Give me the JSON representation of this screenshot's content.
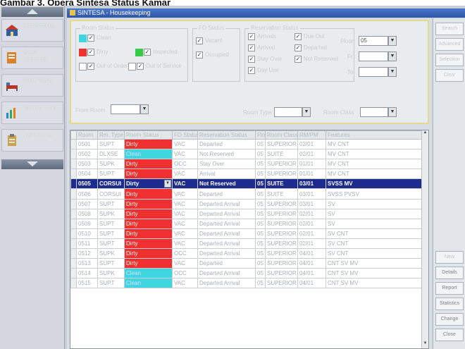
{
  "caption": "Gambar 3. Opera Sintesa Status Kamar",
  "window": {
    "title": "SINTESA - Housekeeping"
  },
  "nav": {
    "items": [
      {
        "label": "Housekeeping",
        "icon": "house-icon"
      },
      {
        "label": "Guest Credentials",
        "icon": "document-icon"
      },
      {
        "label": "Room Status",
        "icon": "bed-icon"
      },
      {
        "label": "Situation Chart",
        "icon": "chart-icon"
      },
      {
        "label": "Maintenance",
        "icon": "clipboard-icon"
      }
    ]
  },
  "filters": {
    "room_status": {
      "title": "Room Status",
      "clean": "Clean",
      "dirty": "Dirty",
      "inspected": "Inspected",
      "out_of_order": "Out of Order",
      "out_of_service": "Out of Service"
    },
    "fo_status": {
      "title": "FO Status",
      "vacant": "Vacant",
      "occupied": "Occupied"
    },
    "reservation_status": {
      "title": "Reservation Status",
      "arrivals": "Arrivals",
      "arrived": "Arrived",
      "stay_over": "Stay Over",
      "day_use": "Day Use",
      "due_out": "Due Out",
      "departed": "Departed",
      "not_reserved": "Not Reserved"
    },
    "floor_label": "Floor",
    "floor_value": "05",
    "from_label": "Fr",
    "to_label": "To",
    "from_room_label": "From Room",
    "room_type_label": "Room Type",
    "room_class_label": "Room Class"
  },
  "grid": {
    "columns": [
      "Room",
      "Rm. Type",
      "Room Status",
      "FO Status",
      "Reservation Status",
      "Floor",
      "Room Class",
      "RM/PM",
      "Features"
    ],
    "rows": [
      {
        "room": "0501",
        "type": "SUPT",
        "status": "Dirty",
        "fo": "VAC",
        "res": "Departed",
        "floor": "05",
        "cls": "SUPERIOR",
        "rmpm": "02/01",
        "features": "MV CNT",
        "kind": "dirty"
      },
      {
        "room": "0502",
        "type": "DLXSE",
        "status": "Clean",
        "fo": "VAC",
        "res": "Not Reserved",
        "floor": "05",
        "cls": "SUITE",
        "rmpm": "02/01",
        "features": "MV CNT",
        "kind": "clean"
      },
      {
        "room": "0503",
        "type": "SUPK",
        "status": "Dirty",
        "fo": "OCC",
        "res": "Stay Over",
        "floor": "05",
        "cls": "SUPERIOR",
        "rmpm": "01/01",
        "features": "MV CNT",
        "kind": "dirty"
      },
      {
        "room": "0504",
        "type": "SUPT",
        "status": "Dirty",
        "fo": "VAC",
        "res": "Arrival",
        "floor": "05",
        "cls": "SUPERIOR",
        "rmpm": "01/01",
        "features": "MV CNT",
        "kind": "dirty"
      },
      {
        "room": "0505",
        "type": "CORSUI",
        "status": "Dirty",
        "fo": "VAC",
        "res": "Not Reserved",
        "floor": "05",
        "cls": "SUITE",
        "rmpm": "03/01",
        "features": "SVSS MV",
        "kind": "combo",
        "selected": true
      },
      {
        "room": "0506",
        "type": "CORSUI",
        "status": "Dirty",
        "fo": "VAC",
        "res": "Departed",
        "floor": "05",
        "cls": "SUITE",
        "rmpm": "03/01",
        "features": "SVSS PVSV",
        "kind": "dirty"
      },
      {
        "room": "0507",
        "type": "SUPT",
        "status": "Dirty",
        "fo": "VAC",
        "res": "Departed Arrival",
        "floor": "05",
        "cls": "SUPERIOR",
        "rmpm": "03/01",
        "features": "SV",
        "kind": "dirty"
      },
      {
        "room": "0508",
        "type": "SUPK",
        "status": "Dirty",
        "fo": "VAC",
        "res": "Departed Arrival",
        "floor": "05",
        "cls": "SUPERIOR",
        "rmpm": "02/01",
        "features": "SV",
        "kind": "dirty"
      },
      {
        "room": "0509",
        "type": "SUPT",
        "status": "Dirty",
        "fo": "VAC",
        "res": "Departed Arrival",
        "floor": "05",
        "cls": "SUPERIOR",
        "rmpm": "02/01",
        "features": "SV",
        "kind": "dirty"
      },
      {
        "room": "0510",
        "type": "SUPT",
        "status": "Dirty",
        "fo": "VAC",
        "res": "Departed Arrival",
        "floor": "05",
        "cls": "SUPERIOR",
        "rmpm": "02/01",
        "features": "SV CNT",
        "kind": "dirty"
      },
      {
        "room": "0511",
        "type": "SUPT",
        "status": "Dirty",
        "fo": "VAC",
        "res": "Departed Arrival",
        "floor": "05",
        "cls": "SUPERIOR",
        "rmpm": "02/01",
        "features": "SV CNT",
        "kind": "dirty"
      },
      {
        "room": "0512",
        "type": "SUPK",
        "status": "Dirty",
        "fo": "OCC",
        "res": "Departed Arrival",
        "floor": "05",
        "cls": "SUPERIOR",
        "rmpm": "04/01",
        "features": "SV CNT",
        "kind": "dirty"
      },
      {
        "room": "0513",
        "type": "SUPT",
        "status": "Dirty",
        "fo": "VAC",
        "res": "Departed",
        "floor": "05",
        "cls": "SUPERIOR",
        "rmpm": "04/01",
        "features": "CNT SV MV",
        "kind": "dirty"
      },
      {
        "room": "0514",
        "type": "SUPK",
        "status": "Clean",
        "fo": "OCC",
        "res": "Departed Arrival",
        "floor": "05",
        "cls": "SUPERIOR",
        "rmpm": "04/01",
        "features": "CNT SV MV",
        "kind": "clean"
      },
      {
        "room": "0515",
        "type": "SUPT",
        "status": "Clean",
        "fo": "VAC",
        "res": "Departed Arrival",
        "floor": "05",
        "cls": "SUPERIOR",
        "rmpm": "04/01",
        "features": "CNT SV MV",
        "kind": "clean"
      }
    ]
  },
  "right_buttons": {
    "top": [
      "Search",
      "Advanced",
      "Selection",
      "Clear"
    ],
    "bottom": [
      "New",
      "Details",
      "Report",
      "Statistics",
      "Change",
      "Close"
    ]
  },
  "colors": {
    "dirty": "#f03030",
    "clean": "#3fd6e0",
    "inspected": "#33cc44",
    "selected_row": "#1d2a8e"
  }
}
